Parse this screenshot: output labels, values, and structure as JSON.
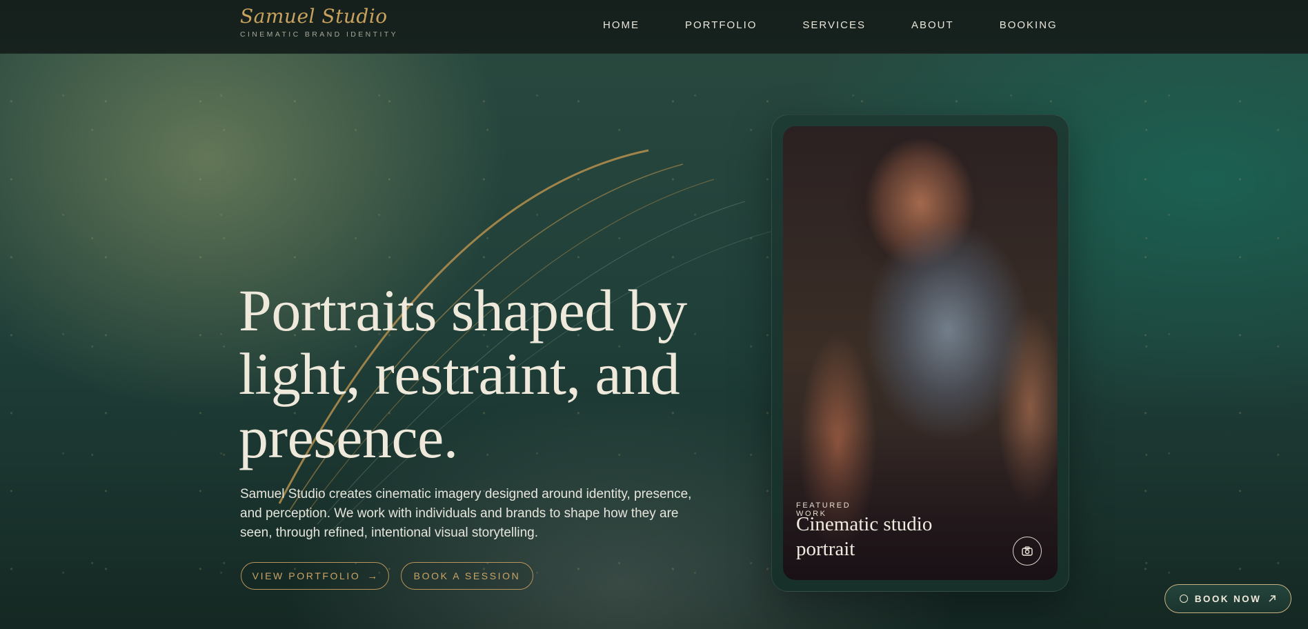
{
  "brand": {
    "name": "Samuel Studio",
    "tagline": "CINEMATIC BRAND IDENTITY",
    "accent": "#c9a25f"
  },
  "nav": {
    "items": [
      "HOME",
      "PORTFOLIO",
      "SERVICES",
      "ABOUT",
      "BOOKING"
    ]
  },
  "hero": {
    "title": "Portraits shaped by light, restraint, and presence.",
    "description": "Samuel Studio creates cinematic imagery designed around identity, presence, and perception. We work with individuals and brands to shape how they are seen, through refined, intentional visual storytelling.",
    "primary_cta": "VIEW PORTFOLIO",
    "secondary_cta": "BOOK A SESSION"
  },
  "featured": {
    "label": "FEATURED WORK",
    "title": "Cinematic studio portrait",
    "camera_icon": "camera-icon"
  },
  "floating": {
    "label": "BOOK NOW",
    "icon_left": "circle-icon",
    "icon_right": "arrow-up-right-icon"
  },
  "colors": {
    "bg": "#1f3e38",
    "nav_bg": "#15201c",
    "gold": "#b8955a",
    "text": "#efe9dc"
  }
}
